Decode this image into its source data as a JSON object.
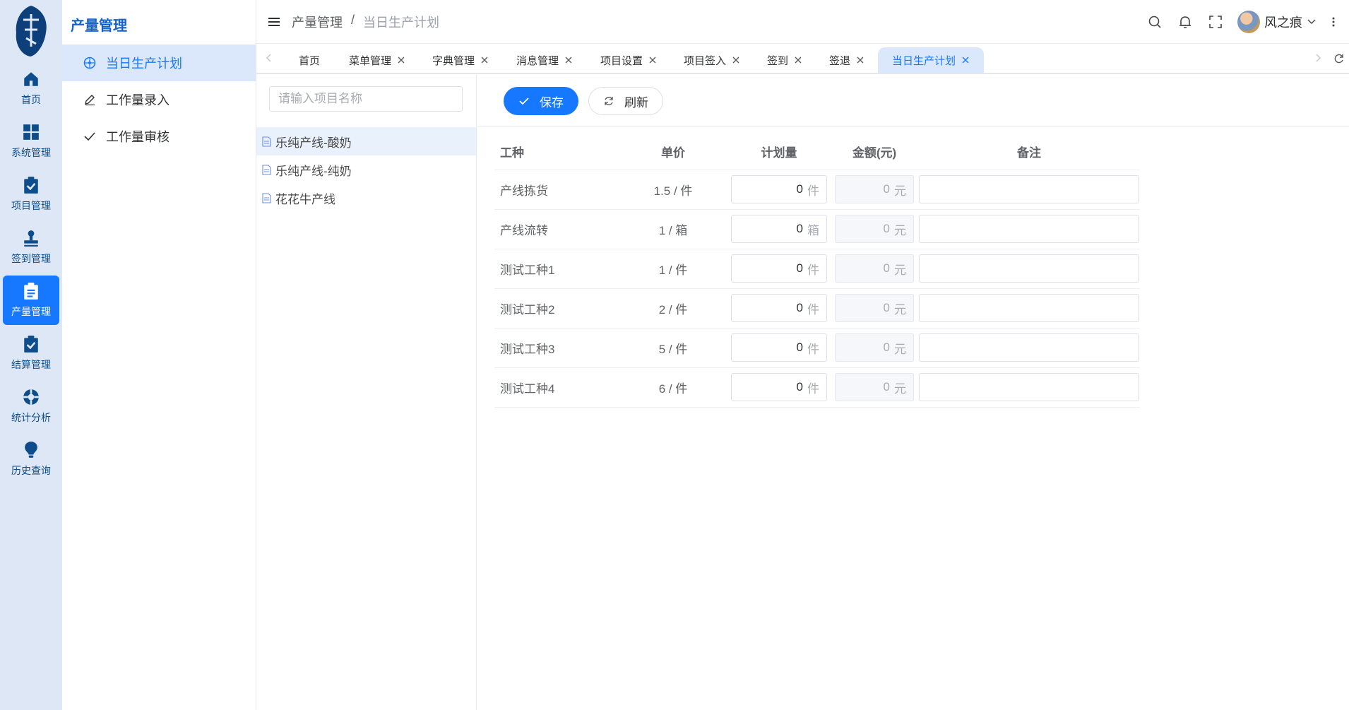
{
  "rail": {
    "items": [
      {
        "label": "首页",
        "icon": "home-icon"
      },
      {
        "label": "系统管理",
        "icon": "grid-icon"
      },
      {
        "label": "项目管理",
        "icon": "clipboard-check-icon"
      },
      {
        "label": "签到管理",
        "icon": "stamp-icon"
      },
      {
        "label": "产量管理",
        "icon": "clipboard-list-icon",
        "active": true
      },
      {
        "label": "结算管理",
        "icon": "clipboard-check-icon"
      },
      {
        "label": "统计分析",
        "icon": "lifebuoy-icon"
      },
      {
        "label": "历史查询",
        "icon": "lightbulb-icon"
      }
    ]
  },
  "submenu": {
    "title": "产量管理",
    "items": [
      {
        "label": "当日生产计划",
        "icon": "compass-icon",
        "active": true
      },
      {
        "label": "工作量录入",
        "icon": "pen-icon"
      },
      {
        "label": "工作量审核",
        "icon": "check-icon"
      }
    ]
  },
  "header": {
    "breadcrumb": [
      "产量管理",
      "当日生产计划"
    ],
    "separator": "/",
    "username": "风之痕"
  },
  "tabs": [
    {
      "label": "首页",
      "closable": false
    },
    {
      "label": "菜单管理",
      "closable": true
    },
    {
      "label": "字典管理",
      "closable": true
    },
    {
      "label": "消息管理",
      "closable": true
    },
    {
      "label": "项目设置",
      "closable": true
    },
    {
      "label": "项目签入",
      "closable": true
    },
    {
      "label": "签到",
      "closable": true
    },
    {
      "label": "签退",
      "closable": true
    },
    {
      "label": "当日生产计划",
      "closable": true,
      "active": true
    }
  ],
  "tree": {
    "search_placeholder": "请输入项目名称",
    "items": [
      {
        "label": "乐纯产线-酸奶",
        "active": true
      },
      {
        "label": "乐纯产线-纯奶"
      },
      {
        "label": "花花牛产线"
      }
    ]
  },
  "toolbar": {
    "save_label": "保存",
    "refresh_label": "刷新"
  },
  "table": {
    "headers": {
      "type": "工种",
      "price": "单价",
      "plan": "计划量",
      "amount": "金额(元)",
      "note": "备注"
    },
    "rows": [
      {
        "type": "产线拣货",
        "price": "1.5 / 件",
        "plan": "0",
        "plan_unit": "件",
        "amount": "0",
        "amount_unit": "元",
        "note": ""
      },
      {
        "type": "产线流转",
        "price": "1 / 箱",
        "plan": "0",
        "plan_unit": "箱",
        "amount": "0",
        "amount_unit": "元",
        "note": ""
      },
      {
        "type": "测试工种1",
        "price": "1 / 件",
        "plan": "0",
        "plan_unit": "件",
        "amount": "0",
        "amount_unit": "元",
        "note": ""
      },
      {
        "type": "测试工种2",
        "price": "2 / 件",
        "plan": "0",
        "plan_unit": "件",
        "amount": "0",
        "amount_unit": "元",
        "note": ""
      },
      {
        "type": "测试工种3",
        "price": "5 / 件",
        "plan": "0",
        "plan_unit": "件",
        "amount": "0",
        "amount_unit": "元",
        "note": ""
      },
      {
        "type": "测试工种4",
        "price": "6 / 件",
        "plan": "0",
        "plan_unit": "件",
        "amount": "0",
        "amount_unit": "元",
        "note": ""
      }
    ]
  },
  "colors": {
    "accent": "#1677ff",
    "rail_bg": "#dde7f5",
    "active_bg": "#dbe8fb",
    "brand_dark": "#0d4d8c"
  }
}
